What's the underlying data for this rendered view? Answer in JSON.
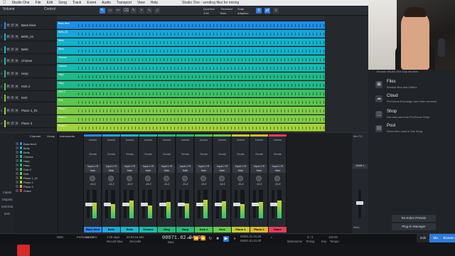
{
  "menubar": {
    "items": [
      "Studio One",
      "File",
      "Edit",
      "Song",
      "Track",
      "Event",
      "Audio",
      "Transport",
      "View",
      "Help"
    ],
    "title": "Studio One - sending files for mixing"
  },
  "toolbar": {
    "section1": "Volume",
    "section2": "Control",
    "quantize_label": "Quantize",
    "quantize_value": "1/16",
    "timebase_label": "Timebase",
    "timebase_value": "Bars",
    "snap_label": "Snap",
    "snap_value": "Adaptive"
  },
  "tracks": [
    {
      "num": "1",
      "name": "Bass feed",
      "color": "#2d86e6"
    },
    {
      "num": "2",
      "name": "Bells_01",
      "color": "#1fa6d8"
    },
    {
      "num": "3",
      "name": "Bells",
      "color": "#1fb4c8"
    },
    {
      "num": "4",
      "name": "Chimes",
      "color": "#1fbaa8"
    },
    {
      "num": "5",
      "name": "Harp",
      "color": "#28b87a"
    },
    {
      "num": "6",
      "name": "Kick 2",
      "color": "#4cc25a"
    },
    {
      "num": "7",
      "name": "Kick",
      "color": "#6cc84e"
    },
    {
      "num": "8",
      "name": "Piano 1_01",
      "color": "#8ed048"
    },
    {
      "num": "9",
      "name": "Piano 2",
      "color": "#a8d43e"
    }
  ],
  "clips": [
    {
      "label": "Bass feed",
      "color": "#1f8ee6"
    },
    {
      "label": "Bells_01",
      "color": "#18a6d8"
    },
    {
      "label": "Bells",
      "color": "#14b2cc"
    },
    {
      "label": "Bells",
      "color": "#14b2cc"
    },
    {
      "label": "Chimes",
      "color": "#19b8b0"
    },
    {
      "label": "Chimes",
      "color": "#19b8b0"
    },
    {
      "label": "Harp",
      "color": "#20b88a"
    },
    {
      "label": "Harp",
      "color": "#20b88a"
    },
    {
      "label": "Kick 2",
      "color": "#3cc064"
    },
    {
      "label": "Kick",
      "color": "#5cc64e"
    },
    {
      "label": "Piano 1",
      "color": "#7ecc48"
    },
    {
      "label": "Piano 1",
      "color": "#7ecc48"
    },
    {
      "label": "Piano 2",
      "color": "#a2d23e"
    }
  ],
  "mixer_nav": [
    "Inputs",
    "Outputs",
    "External",
    "Instr",
    "Remote"
  ],
  "channel_list": {
    "headers": [
      "Channel",
      "Group"
    ],
    "rows": [
      {
        "name": "Bass feed",
        "color": "#2d86e6"
      },
      {
        "name": "Bells",
        "color": "#1fa6d8"
      },
      {
        "name": "Bells",
        "color": "#1fb4c8"
      },
      {
        "name": "Chimes",
        "color": "#1fbaa8"
      },
      {
        "name": "Harp",
        "color": "#28b87a"
      },
      {
        "name": "Harp",
        "color": "#28b87a"
      },
      {
        "name": "Kick 2",
        "color": "#4cc25a"
      },
      {
        "name": "Kick",
        "color": "#6cc84e"
      },
      {
        "name": "Piano 1_01",
        "color": "#8ed048"
      },
      {
        "name": "Piano 2",
        "color": "#a8d43e"
      },
      {
        "name": "Piano 3",
        "color": "#c6c83a"
      },
      {
        "name": "Snare",
        "color": "#e0405a"
      }
    ]
  },
  "instruments_label": "Instruments",
  "strips": [
    {
      "name": "Bass feed",
      "color": "#2d86e6",
      "gain": "-11.2",
      "level": 0.55
    },
    {
      "name": "Bells",
      "color": "#1fa6d8",
      "gain": "-11.2",
      "level": 0.5
    },
    {
      "name": "Bells",
      "color": "#1fb4c8",
      "gain": "-11.2",
      "level": 0.62
    },
    {
      "name": "Chimes",
      "color": "#1fbaa8",
      "gain": "-11.2",
      "level": 0.45
    },
    {
      "name": "Harp",
      "color": "#28b87a",
      "gain": "-11.2",
      "level": 0.58
    },
    {
      "name": "Harp",
      "color": "#28b87a",
      "gain": "-11.2",
      "level": 0.52
    },
    {
      "name": "Kick 2",
      "color": "#4cc25a",
      "gain": "-11.2",
      "level": 0.66
    },
    {
      "name": "Kick",
      "color": "#6cc84e",
      "gain": "-11.2",
      "level": 0.6
    },
    {
      "name": "Piano 1",
      "color": "#c6c83a",
      "gain": "-11.2",
      "level": 0.5
    },
    {
      "name": "Piano 2",
      "color": "#d8b63a",
      "gain": "-11.2",
      "level": 0.57
    },
    {
      "name": "Snare",
      "color": "#e0405a",
      "gain": "-11.2",
      "level": 0.63
    }
  ],
  "strip_labels": {
    "inserts": "Inserts",
    "sends": "Sends",
    "io_in": "Input L+R",
    "io_out": "Main"
  },
  "master": {
    "label": "Mix FX",
    "io": "MAIN 1",
    "monitor": "Main"
  },
  "browser": {
    "subtitle": "Browse Studio One loop libraries",
    "items": [
      {
        "icon": "folder-icon",
        "title": "Files",
        "desc": "Browse files and folders"
      },
      {
        "icon": "cloud-icon",
        "title": "Cloud",
        "desc": "PreSonus Exchange and other services"
      },
      {
        "icon": "shop-icon",
        "title": "Shop",
        "desc": "Get add-ons from PreSonus Shop"
      },
      {
        "icon": "pool-icon",
        "title": "Pool",
        "desc": "Show files used in this Song"
      }
    ],
    "re_index": "Re-Index Presets",
    "plugin_manager": "Plug-In Manager"
  },
  "transport": {
    "sample_rate": "44.1 kHz",
    "record_max": "1:09 days",
    "time": "00:03:16.894",
    "position": "00071.02.04.07",
    "left_loc": "00001.01.01.00",
    "right_loc": "00001.01.01.00",
    "sig": "4 / 4",
    "tempo": "120.00",
    "labels": [
      "MIDI",
      "Performance",
      "Record Max",
      "Seconds",
      "Bars",
      "Metronome",
      "Timing",
      "Key",
      "Tempo"
    ]
  },
  "bottom_tabs": [
    "Edit",
    "Mix",
    "Browse"
  ]
}
